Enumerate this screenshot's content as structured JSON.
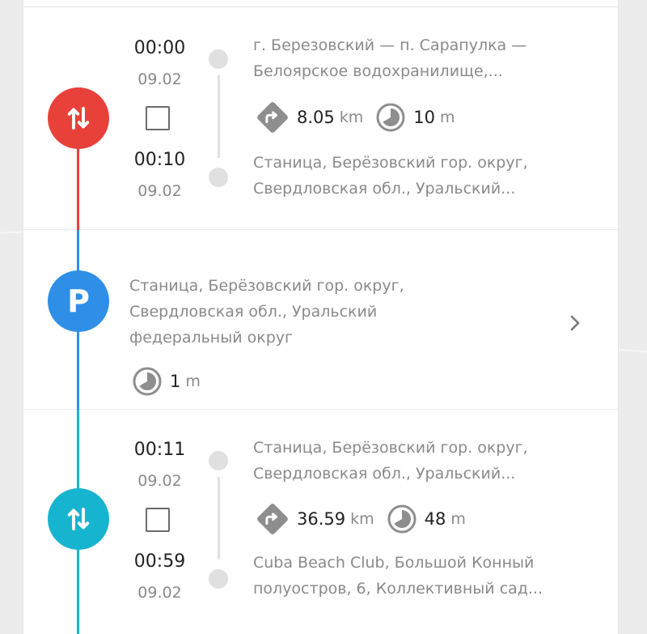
{
  "trips": [
    {
      "color": "#e8413a",
      "start_time": "00:00",
      "start_date": "09.02",
      "end_time": "00:10",
      "end_date": "09.02",
      "from_line1": "г. Березовский — п. Сарапулка —",
      "from_line2": "Белоярское водохранилище,...",
      "to_line1": "Станица, Берёзовский гор. округ,",
      "to_line2": "Свердловская обл., Уральский...",
      "distance_value": "8.05",
      "distance_unit": "km",
      "duration_value": "10",
      "duration_unit": "m"
    },
    {
      "color": "#17b4cf",
      "start_time": "00:11",
      "start_date": "09.02",
      "end_time": "00:59",
      "end_date": "09.02",
      "from_line1": "Станица, Берёзовский гор. округ,",
      "from_line2": "Свердловская обл., Уральский...",
      "to_line1": "Cuba Beach Club, Большой Конный",
      "to_line2": "полуостров, 6, Коллективный сад...",
      "distance_value": "36.59",
      "distance_unit": "km",
      "duration_value": "48",
      "duration_unit": "m"
    }
  ],
  "parking": {
    "color": "#2f8fe6",
    "badge_letter": "P",
    "line1": "Станица, Берёзовский гор. округ,",
    "line2": "Свердловская обл., Уральский",
    "line3": "федеральный округ",
    "duration_value": "1",
    "duration_unit": "m"
  },
  "icons": {
    "trip_badge": "swap-vertical-arrows-icon",
    "checkbox": "checkbox-icon",
    "distance": "turn-right-diamond-icon",
    "duration": "clock-pie-icon",
    "expand": "chevron-right-icon"
  }
}
